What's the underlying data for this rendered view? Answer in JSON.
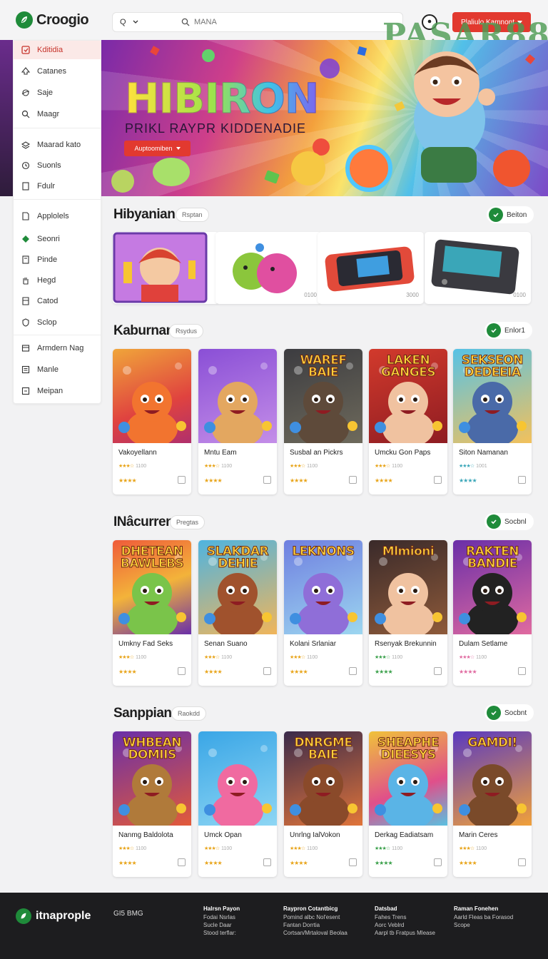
{
  "header": {
    "logo": "Croogio",
    "search_scope": "Q",
    "search_placeholder": "MANA",
    "action_button": "Plaliulo Kamnont",
    "watermark": "PASAR88"
  },
  "sidebar": {
    "items": [
      {
        "label": "Kditidia",
        "icon": "grid-icon"
      },
      {
        "label": "Catanes",
        "icon": "spade-icon"
      },
      {
        "label": "Saje",
        "icon": "planet-icon"
      },
      {
        "label": "Maagr",
        "icon": "search-icon"
      },
      {
        "label": "Maarad kato",
        "icon": "stack-icon"
      },
      {
        "label": "Suonls",
        "icon": "clock-icon"
      },
      {
        "label": "Fdulr",
        "icon": "doc-icon"
      },
      {
        "label": "Applolels",
        "icon": "page-icon"
      },
      {
        "label": "Seonri",
        "icon": "tag-icon"
      },
      {
        "label": "Pinde",
        "icon": "doc-icon"
      },
      {
        "label": "Hegd",
        "icon": "hand-icon"
      },
      {
        "label": "Catod",
        "icon": "sheet-icon"
      },
      {
        "label": "Sclop",
        "icon": "shield-icon"
      },
      {
        "label": "Armdern Nag",
        "icon": "box-icon"
      },
      {
        "label": "Manle",
        "icon": "list-icon"
      },
      {
        "label": "Meipan",
        "icon": "box-icon"
      }
    ]
  },
  "hero": {
    "title": "HIBIRON",
    "subtitle": "PRIKL RAYPR KIDDENADIE",
    "button": "Auptoomiben"
  },
  "featured": {
    "title": "Hibyanian",
    "pill": "Rsptan",
    "see": "Beiton",
    "cards": [
      {
        "count": ""
      },
      {
        "count": "0100"
      },
      {
        "count": "3000"
      },
      {
        "count": "0100"
      }
    ]
  },
  "sections": [
    {
      "title": "Kaburnan",
      "pill": "Rsydus",
      "see": "Enlor1",
      "games": [
        {
          "name": "Vakoyellann",
          "rating_count": "1100",
          "banner": ""
        },
        {
          "name": "Mntu Eam",
          "rating_count": "1100",
          "banner": ""
        },
        {
          "name": "Susbal an Pickrs",
          "rating_count": "1100",
          "banner": "WAREF BAIE"
        },
        {
          "name": "Umcku Gon Paps",
          "rating_count": "1100",
          "banner": "LAKEN GANGES"
        },
        {
          "name": "Siton Namanan",
          "rating_count": "1001",
          "banner": "SEKSEON DEDEEIA"
        }
      ]
    },
    {
      "title": "INâcurren",
      "pill": "Pregtas",
      "see": "Socbnl",
      "games": [
        {
          "name": "Umkny Fad Seks",
          "rating_count": "1100",
          "banner": "DHETEAN BAWLEBS"
        },
        {
          "name": "Senan Suano",
          "rating_count": "1100",
          "banner": "SLAKDAR DEHIE"
        },
        {
          "name": "Kolani Srlaniar",
          "rating_count": "1100",
          "banner": "LEKNONS"
        },
        {
          "name": "Rsenyak Brekunnin",
          "rating_count": "1100",
          "banner": "Mlmioni"
        },
        {
          "name": "Dulam Setlame",
          "rating_count": "1100",
          "banner": "RAKTEN BANDIE"
        }
      ]
    },
    {
      "title": "Sanppian",
      "pill": "Raokdd",
      "see": "Socbnt",
      "games": [
        {
          "name": "Nanmg Baldolota",
          "rating_count": "1100",
          "banner": "WHBEAN DOMIIS"
        },
        {
          "name": "Umck Opan",
          "rating_count": "1100",
          "banner": ""
        },
        {
          "name": "Unrlng IalVokon",
          "rating_count": "1100",
          "banner": "DNRGME BAIE"
        },
        {
          "name": "Derkag Eadiatsam",
          "rating_count": "1100",
          "banner": "SHEAPHE DIEESYS"
        },
        {
          "name": "Marin Ceres",
          "rating_count": "1100",
          "banner": "GAMDI!"
        }
      ]
    }
  ],
  "footer": {
    "logo": "itnaprople",
    "copyright": "GI5 BMG",
    "columns": [
      {
        "heading": "Halrsn Payon",
        "links": [
          "Fodai Nsrlas",
          "Sucle Daar",
          "Stood terflar:"
        ]
      },
      {
        "heading": "Raypron Cotantbicg",
        "links": [
          "Pomind albc Nol'esent",
          "Fantan Dorrtia",
          "Cortsan/Mrtaloval Beolaa"
        ]
      },
      {
        "heading": "Datsbad",
        "links": [
          "Fahes Trens",
          "Aorc Veblrd",
          "Aarpl tb Fratpus Mlease"
        ]
      },
      {
        "heading": "Raman Fonehen",
        "links": [
          "Aarld Fleas ba Forasod",
          "Scope"
        ]
      }
    ]
  },
  "colors": {
    "accent": "#e2392f",
    "brand_green": "#1f8b3a",
    "star": "#e8a419"
  }
}
